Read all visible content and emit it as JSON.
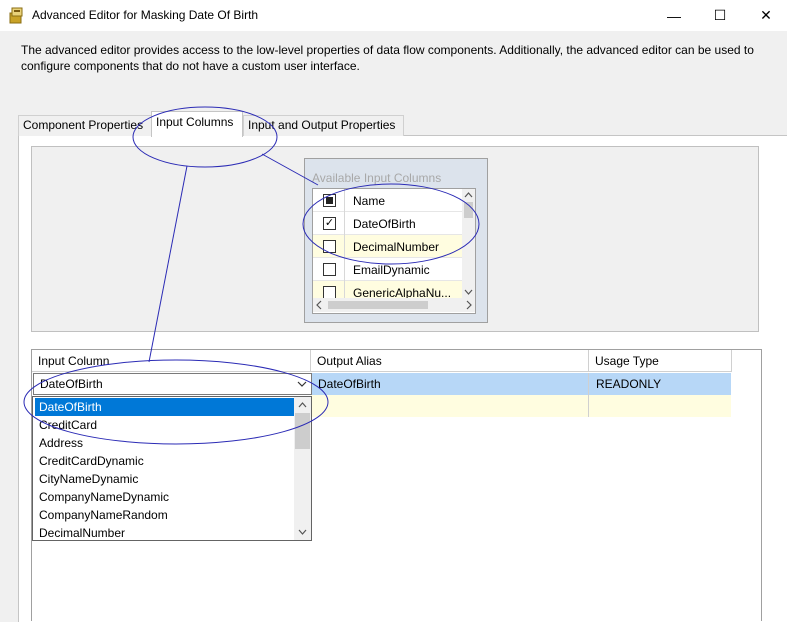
{
  "window": {
    "title": "Advanced Editor for Masking Date Of Birth",
    "minimize_glyph": "—",
    "maximize_glyph": "☐",
    "close_glyph": "✕"
  },
  "description": "The advanced editor provides access to the low-level properties of data flow components. Additionally, the advanced editor can be used to configure components that do not have a custom user interface.",
  "tabs": [
    {
      "label": "Component Properties"
    },
    {
      "label": "Input Columns"
    },
    {
      "label": "Input and Output Properties"
    }
  ],
  "available_columns": {
    "title": "Available Input Columns",
    "header": "Name",
    "rows": [
      {
        "name": "DateOfBirth",
        "checked": true
      },
      {
        "name": "DecimalNumber",
        "checked": false
      },
      {
        "name": "EmailDynamic",
        "checked": false
      },
      {
        "name": "GenericAlphaNu...",
        "checked": false
      }
    ]
  },
  "grid": {
    "headers": [
      "Input Column",
      "Output Alias",
      "Usage Type"
    ],
    "row": {
      "input_column": "DateOfBirth",
      "output_alias": "DateOfBirth",
      "usage_type": "READONLY"
    }
  },
  "dropdown": {
    "selected": "DateOfBirth",
    "options": [
      "DateOfBirth",
      "CreditCard",
      "Address",
      "CreditCardDynamic",
      "CityNameDynamic",
      "CompanyNameDynamic",
      "CompanyNameRandom",
      "DecimalNumber"
    ]
  },
  "colors": {
    "selection": "#0078d7",
    "row_highlight": "#b7d7f7",
    "alt_row": "#fffde0",
    "annotation": "#2b2bb5"
  }
}
